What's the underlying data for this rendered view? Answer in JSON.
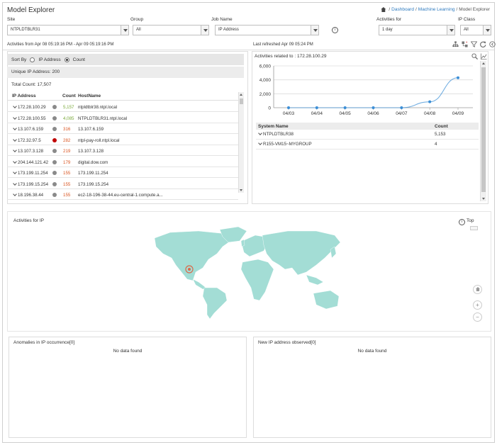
{
  "header": {
    "title": "Model Explorer",
    "breadcrumb": {
      "dashboard": "Dashboard",
      "ml": "Machine Learning",
      "current": "Model Explorer",
      "sep": "/"
    }
  },
  "filters": {
    "site": {
      "label": "Site",
      "value": "NTPLDTBLR31"
    },
    "group": {
      "label": "Group",
      "value": "All"
    },
    "job": {
      "label": "Job Name",
      "value": "IP Address"
    },
    "activities_for": {
      "label": "Activities for",
      "value": "1 day"
    },
    "ip_class": {
      "label": "IP Class",
      "value": "All"
    }
  },
  "status": {
    "range": "Activities from Apr 08 05:19:16 PM - Apr 09 05:19:16 PM",
    "refreshed": "Last refreshed Apr 09 05:24 PM"
  },
  "left_panel": {
    "sort_by": "Sort By",
    "option_ip": "IP Address",
    "option_count": "Count",
    "unique": "Unique IP Address: 200",
    "total": "Total Count: 17,507",
    "columns": {
      "ip": "IP Address",
      "count": "Count",
      "host": "HostName"
    },
    "rows": [
      {
        "ip": "172.28.100.29",
        "count": "5,157",
        "host": "ntpldtblr38.ntpl.local",
        "dot": "#8a8a8a",
        "color": "#7aa83a"
      },
      {
        "ip": "172.28.100.55",
        "count": "4,085",
        "host": "NTPLDTBLR31.ntpl.local",
        "dot": "#8a8a8a",
        "color": "#7aa83a"
      },
      {
        "ip": "13.107.6.159",
        "count": "316",
        "host": "13.107.6.159",
        "dot": "#8a8a8a",
        "color": "#d9531e"
      },
      {
        "ip": "172.32.97.5",
        "count": "282",
        "host": "ntpl-pay-roll.ntpl.local",
        "dot": "#c00000",
        "color": "#d9531e"
      },
      {
        "ip": "13.107.3.128",
        "count": "219",
        "host": "13.107.3.128",
        "dot": "#8a8a8a",
        "color": "#d9531e"
      },
      {
        "ip": "204.144.121.42",
        "count": "179",
        "host": "digital.dow.com",
        "dot": "#8a8a8a",
        "color": "#d9531e"
      },
      {
        "ip": "173.199.11.254",
        "count": "155",
        "host": "173.199.11.254",
        "dot": "#8a8a8a",
        "color": "#d9531e"
      },
      {
        "ip": "173.199.15.254",
        "count": "155",
        "host": "173.199.15.254",
        "dot": "#8a8a8a",
        "color": "#d9531e"
      },
      {
        "ip": "18.196.38.44",
        "count": "155",
        "host": "ec2-18-196-38-44.eu-central-1.compute.a...",
        "dot": "#8a8a8a",
        "color": "#d9531e"
      }
    ]
  },
  "right_panel": {
    "title": "Activities related to : 172.28.100.29",
    "columns": {
      "system": "System Name",
      "count": "Count"
    },
    "rows": [
      {
        "system": "NTPLDTBLR38",
        "count": "5,153"
      },
      {
        "system": "R155-VM15~MYGROUP",
        "count": "4"
      }
    ]
  },
  "chart_data": {
    "type": "line",
    "categories": [
      "04/03",
      "04/04",
      "04/05",
      "04/06",
      "04/07",
      "04/08",
      "04/09"
    ],
    "values": [
      0,
      0,
      0,
      0,
      0,
      850,
      4300
    ],
    "ylim": [
      0,
      6000
    ],
    "yticks": [
      "0",
      "2,000",
      "4,000",
      "6,000"
    ],
    "grid": true,
    "color": "#3b8ed6"
  },
  "map_panel": {
    "title": "Activities for IP",
    "top_label": "Top",
    "land_color": "#a3ddd5",
    "marker_color": "#d9694a"
  },
  "anomalies": {
    "title": "Anomalies in IP occurrence[0]",
    "empty": "No data found"
  },
  "new_ip": {
    "title": "New IP address observed[0]",
    "empty": "No data found"
  },
  "icons": [
    "home-icon",
    "info-icon",
    "hierarchy-icon",
    "filter-icon",
    "refresh-icon",
    "help-icon",
    "zoom-icon",
    "line-chart-icon"
  ]
}
